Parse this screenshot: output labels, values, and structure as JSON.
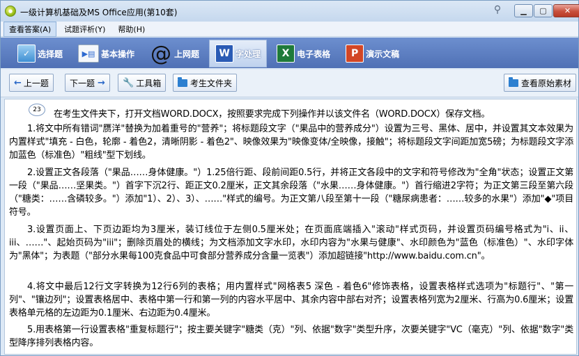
{
  "window": {
    "title": "一级计算机基础及MS Office应用(第10套)",
    "pin_icon": "pin-icon",
    "minimize": "▁",
    "maximize": "▢",
    "close": "✕"
  },
  "menu": {
    "items": [
      "查看答案(A)",
      "试题评析(Y)",
      "帮助(H)"
    ],
    "active_index": 0
  },
  "modules": [
    {
      "label": "选择题",
      "icon": "choice-icon"
    },
    {
      "label": "基本操作",
      "icon": "basic-operation-icon"
    },
    {
      "label": "上网题",
      "icon": "at-icon"
    },
    {
      "label": "字处理",
      "icon": "word-icon",
      "active": true
    },
    {
      "label": "电子表格",
      "icon": "excel-icon"
    },
    {
      "label": "演示文稿",
      "icon": "powerpoint-icon"
    }
  ],
  "nav": {
    "prev": "上一题",
    "next": "下一题",
    "toolbox": "工具箱",
    "student_folder": "考生文件夹",
    "view_original": "查看原始素材"
  },
  "question": {
    "number": "23",
    "intro": "在考生文件夹下，打开文档WORD.DOCX，按照要求完成下列操作并以该文件名（WORD.DOCX）保存文档。",
    "items": [
      "1.将文中所有错词\"赝洋\"替换为加着重号的\"营养\"；将标题段文字（\"果品中的营养成分\"）设置为三号、黑体、居中，并设置其文本效果为内置样式\"填充 - 白色，轮廓 - 着色2，清晰阴影 - 着色2\"、映像效果为\"映像变体/全映像，接触\"；将标题段文字间距加宽5磅；为标题段文字添加蓝色（标准色）\"粗线\"型下划线。",
      "2.设置正文各段落（\"果品……身体健康。\"）1.25倍行距、段前间距0.5行，并将正文各段中的文字和符号修改为\"全角\"状态；设置正文第一段（\"果品……坚果类。\"）首字下沉2行、距正文0.2厘米，正文其余段落（\"水果……身体健康。\"）首行缩进2字符；为正文第三段至第六段（\"糖类：……含磷较多。\"）添加\"1）、2）、3）、……\"样式的编号。为正文第八段至第十一段（\"糖尿病患者：……较多的水果\"）添加\"◆\"项目符号。",
      "3.设置页面上、下页边距均为3厘米，装订线位于左侧0.5厘米处；在页面底端插入\"滚动\"样式页码，并设置页码编号格式为\"i、ii、iii、……\"、起始页码为\"iii\"；删除页眉处的横线；为文档添加文字水印，水印内容为\"水果与健康\"、水印颜色为\"蓝色（标准色）\"、水印字体为\"黑体\"；为表题（\"部分水果每100克食品中可食部分营养成分含量一览表\"）添加超链接\"http://www.baidu.com.cn\"。",
      "4.将文中最后12行文字转换为12行6列的表格；用内置样式\"网格表5 深色 - 着色6\"修饰表格，设置表格样式选项为\"标题行\"、\"第一列\"、\"镶边列\"；设置表格居中、表格中第一行和第一列的内容水平居中、其余内容中部右对齐；设置表格列宽为2厘米、行高为0.6厘米；设置表格单元格的左边距为0.1厘米、右边距为0.4厘米。",
      "5.用表格第一行设置表格\"重复标题行\"；按主要关键字\"糖类（克）\"列、依据\"数字\"类型升序，次要关键字\"VC（毫克）\"列、依据\"数字\"类型降序排列表格内容。"
    ]
  }
}
